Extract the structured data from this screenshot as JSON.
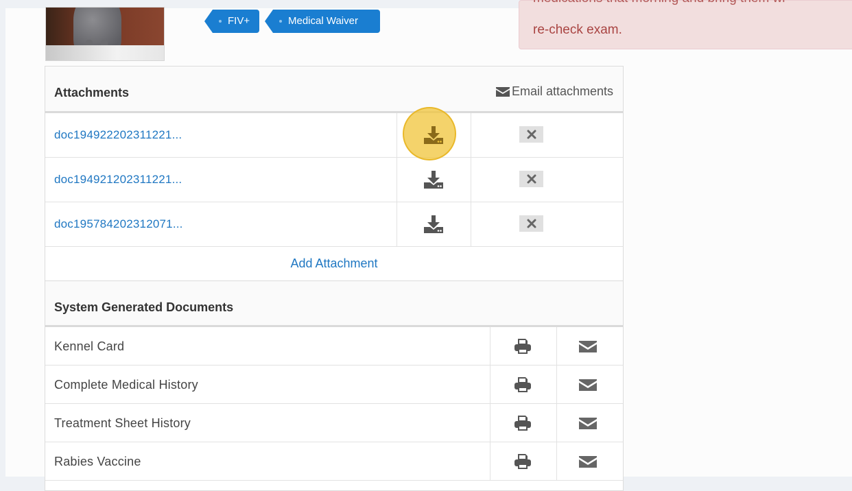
{
  "tags": [
    "FIV+",
    "Medical Waiver"
  ],
  "alert": {
    "line1": "medications that morning and bring them wi",
    "line2": "re-check exam."
  },
  "attachments": {
    "title": "Attachments",
    "email_label": "Email attachments",
    "files": [
      "doc194922202311221...",
      "doc194921202311221...",
      "doc195784202312071..."
    ],
    "add_label": "Add Attachment"
  },
  "system_docs": {
    "title": "System Generated Documents",
    "items": [
      "Kennel Card",
      "Complete Medical History",
      "Treatment Sheet History",
      "Rabies Vaccine"
    ]
  },
  "icons": {
    "email": "envelope-icon",
    "download": "download-icon",
    "delete": "close-icon",
    "print": "printer-icon"
  },
  "colors": {
    "link": "#1f77c2",
    "tag": "#1a7ed1",
    "alert_bg": "#f2dede",
    "alert_text": "#a94442",
    "highlight": "#f0c43a"
  }
}
